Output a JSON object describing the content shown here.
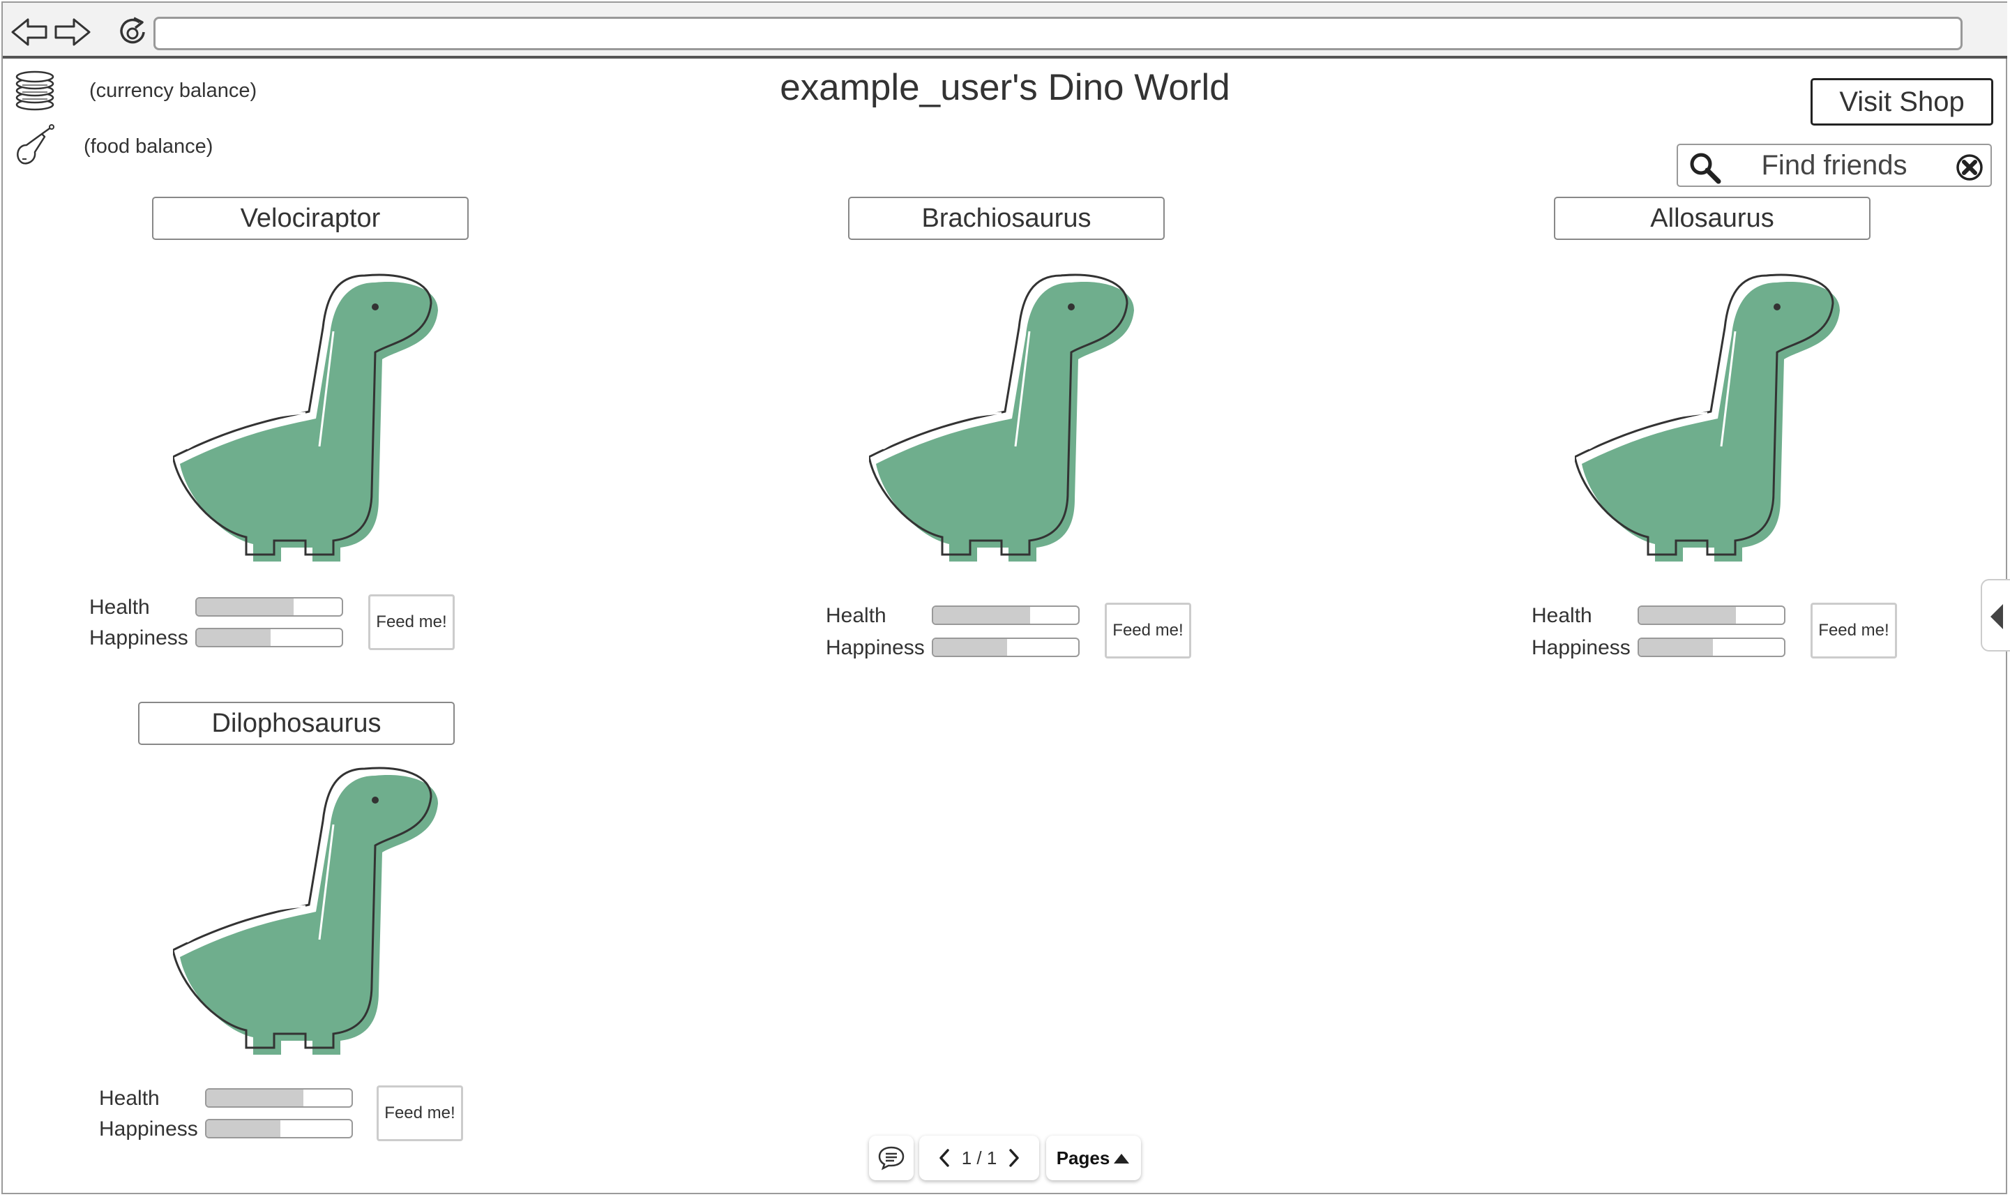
{
  "header": {
    "title": "example_user's Dino World",
    "currency_label": "(currency balance)",
    "food_label": "(food balance)",
    "visit_shop": "Visit Shop",
    "find_friends": "Find friends"
  },
  "dinos": [
    {
      "name": "Velociraptor",
      "health_label": "Health",
      "happiness_label": "Happiness",
      "health": 0.67,
      "happiness": 0.51,
      "feed_label": "Feed me!"
    },
    {
      "name": "Brachiosaurus",
      "health_label": "Health",
      "happiness_label": "Happiness",
      "health": 0.67,
      "happiness": 0.51,
      "feed_label": "Feed me!"
    },
    {
      "name": "Allosaurus",
      "health_label": "Health",
      "happiness_label": "Happiness",
      "health": 0.67,
      "happiness": 0.51,
      "feed_label": "Feed me!"
    },
    {
      "name": "Dilophosaurus",
      "health_label": "Health",
      "happiness_label": "Happiness",
      "health": 0.67,
      "happiness": 0.51,
      "feed_label": "Feed me!"
    }
  ],
  "pagination": {
    "page_indicator": "1 / 1",
    "pages_label": "Pages"
  },
  "icons": {
    "back": "back-arrow-icon",
    "forward": "forward-arrow-icon",
    "reload": "reload-icon",
    "coins": "coin-stack-icon",
    "food": "drumstick-icon",
    "search": "search-icon",
    "clear": "clear-icon",
    "dino": "dinosaur-icon",
    "comment": "comment-icon",
    "prev": "chevron-left-icon",
    "next": "chevron-right-icon",
    "pages_arrow": "triangle-up-icon",
    "side_tab": "chevron-left-icon"
  },
  "colors": {
    "dino_green": "#6fae8d",
    "bar_fill": "#cccccc"
  }
}
